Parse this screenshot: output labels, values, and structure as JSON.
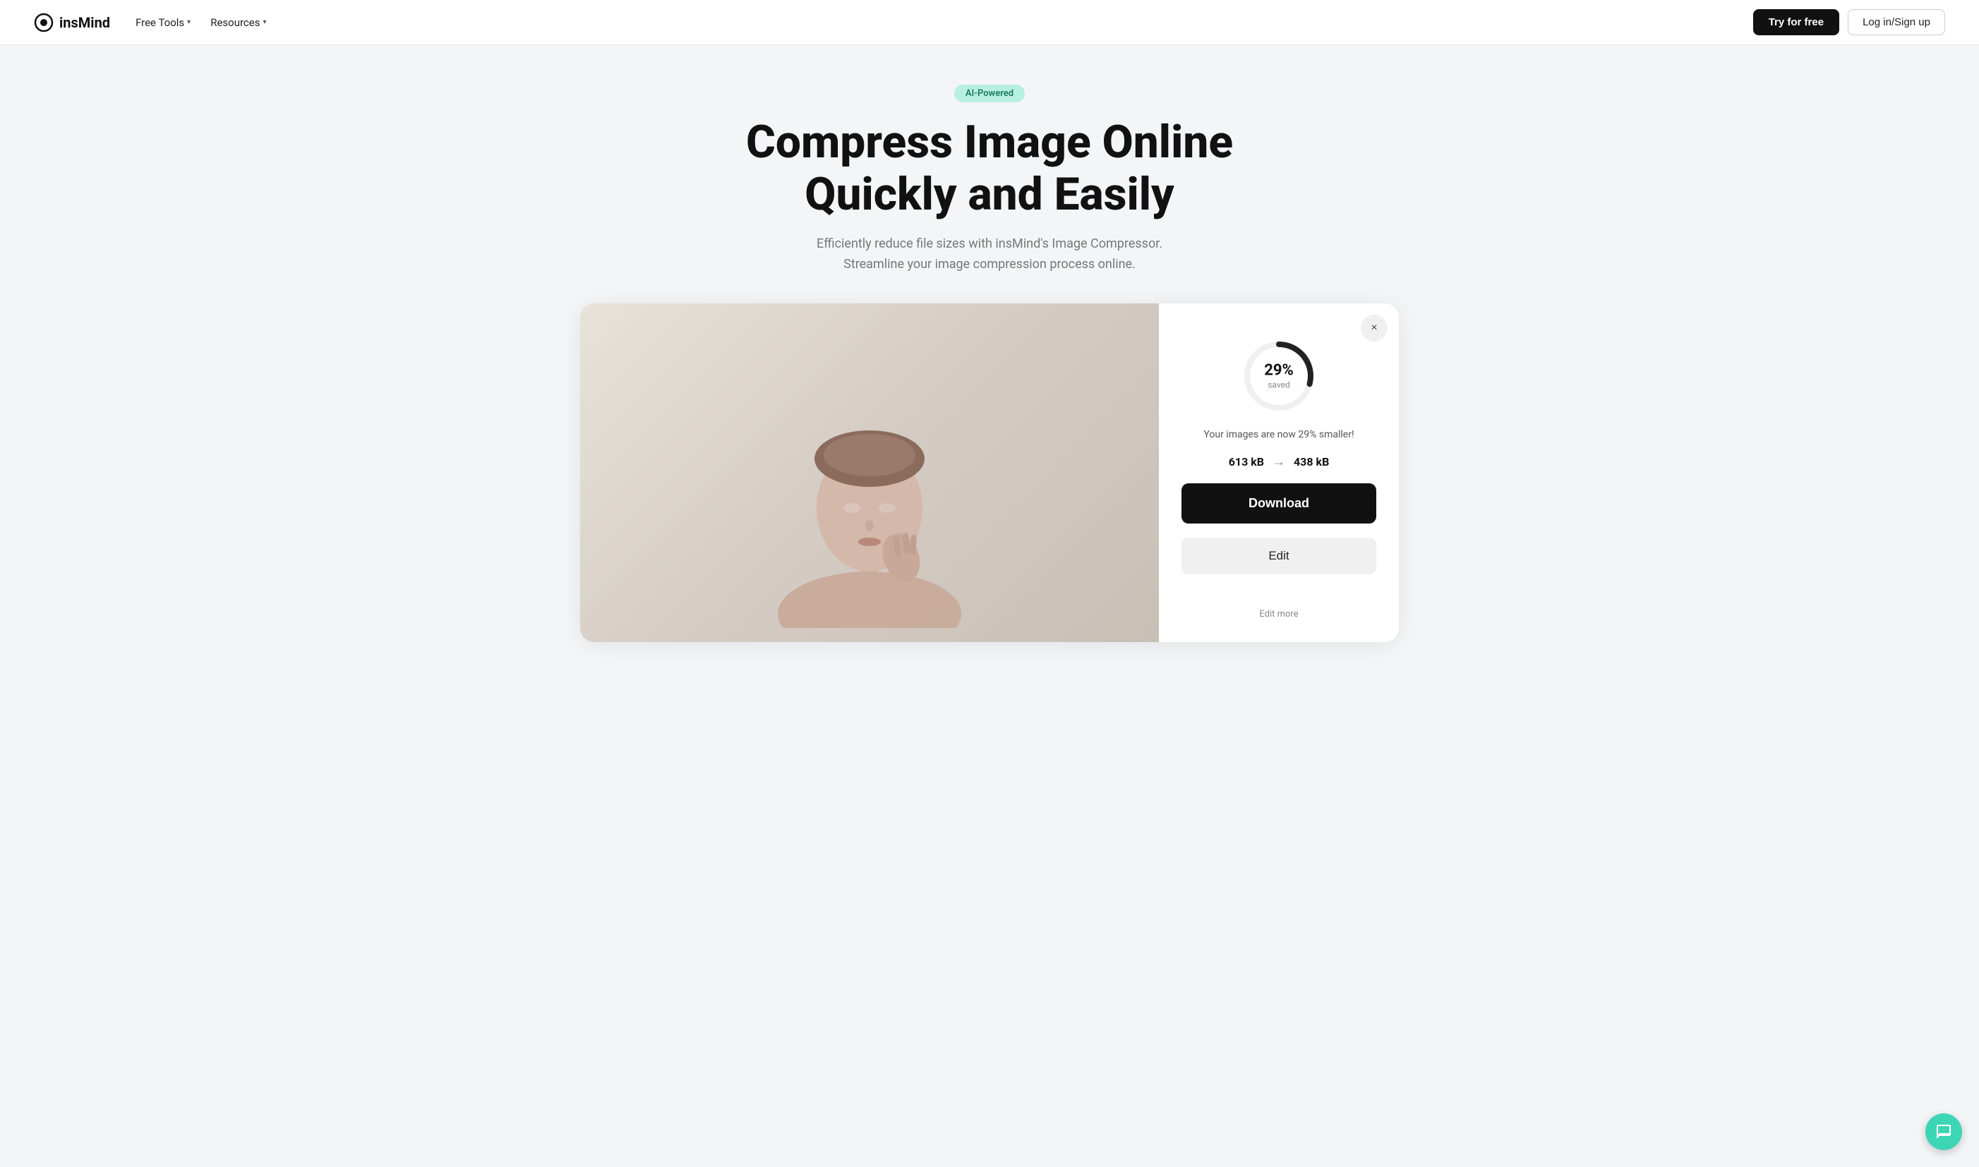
{
  "nav": {
    "logo_text": "insMind",
    "menu_items": [
      {
        "label": "Free Tools",
        "has_dropdown": true
      },
      {
        "label": "Resources",
        "has_dropdown": true
      }
    ],
    "try_label": "Try for free",
    "login_label": "Log in/Sign up"
  },
  "hero": {
    "badge": "AI-Powered",
    "title_line1": "Compress Image Online",
    "title_line2": "Quickly and Easily",
    "subtitle_line1": "Efficiently reduce file sizes with insMind's Image Compressor.",
    "subtitle_line2": "Streamline your image compression process online."
  },
  "tool": {
    "close_label": "×",
    "circle_percent": "29%",
    "circle_saved": "saved",
    "result_message": "Your images are now 29% smaller!",
    "original_size": "613 kB",
    "arrow": "→",
    "compressed_size": "438 kB",
    "download_label": "Download",
    "edit_label": "Edit",
    "edit_more_label": "Edit more"
  }
}
